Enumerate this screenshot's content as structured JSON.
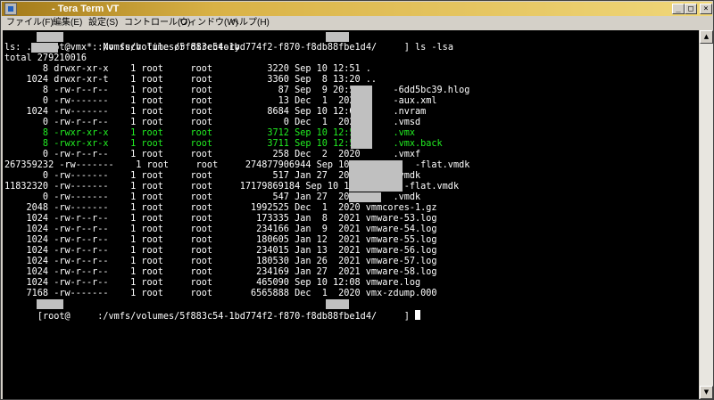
{
  "window": {
    "title": "- Tera Term VT",
    "controls": {
      "minimize": "_",
      "maximize": "□",
      "close": "×"
    }
  },
  "menu": [
    {
      "label": "ファイル(F)"
    },
    {
      "label": "編集(E)"
    },
    {
      "label": "設定(S)"
    },
    {
      "label": "コントロール(O)"
    },
    {
      "label": "ウィンドウ(W)"
    },
    {
      "label": "ヘルプ(H)"
    }
  ],
  "terminal": {
    "colors": {
      "background": "#000000",
      "text": "#ffffff",
      "highlight": "#22ee22",
      "dir": "#3060ff"
    },
    "lines": [
      {
        "text": "[root@     :/vmfs/volumes/5f883c54-1bd774f2-f870-f8db88fbe1d4/     ] ls -lsa"
      },
      {
        "text": "ls: ./     .vmx*: No such file or directory"
      },
      {
        "text": "total 279210016"
      },
      {
        "text": "       8 drwxr-xr-x    1 root     root          3220 Sep 10 12:51 ."
      },
      {
        "text": "    1024 drwxr-xr-t    1 root     root          3360 Sep  8 13:20 .."
      },
      {
        "text": "       8 -rw-r--r--    1 root     root            87 Sep  9 20:56      -6dd5bc39.hlog"
      },
      {
        "text": "       0 -rw-------    1 root     root            13 Dec  1  2020      -aux.xml"
      },
      {
        "text": "    1024 -rw-------    1 root     root          8684 Sep 10 12:08      .nvram"
      },
      {
        "text": "       0 -rw-r--r--    1 root     root             0 Dec  1  2020      .vmsd"
      },
      {
        "text": "       8 -rwxr-xr-x    1 root     root          3712 Sep 10 12:50      .vmx"
      },
      {
        "text": "       8 -rwxr-xr-x    1 root     root          3711 Sep 10 12:50      .vmx.back"
      },
      {
        "text": "       0 -rw-r--r--    1 root     root           258 Dec  2  2020      .vmxf"
      },
      {
        "text": "267359232 -rw-------    1 root     root     274877906944 Sep 10 12:08      -flat.vmdk"
      },
      {
        "text": "       0 -rw-------    1 root     root           517 Jan 27  2021      .vmdk"
      },
      {
        "text": "11832320 -rw-------    1 root     root     17179869184 Sep 10 12:08      -flat.vmdk"
      },
      {
        "text": "       0 -rw-------    1 root     root           547 Jan 27  2021      .vmdk"
      },
      {
        "text": "    2048 -rw-------    1 root     root       1992525 Dec  1  2020 vmmcores-1.gz"
      },
      {
        "text": "    1024 -rw-r--r--    1 root     root        173335 Jan  8  2021 vmware-53.log"
      },
      {
        "text": "    1024 -rw-r--r--    1 root     root        234166 Jan  9  2021 vmware-54.log"
      },
      {
        "text": "    1024 -rw-r--r--    1 root     root        180605 Jan 12  2021 vmware-55.log"
      },
      {
        "text": "    1024 -rw-r--r--    1 root     root        234015 Jan 13  2021 vmware-56.log"
      },
      {
        "text": "    1024 -rw-r--r--    1 root     root        180530 Jan 26  2021 vmware-57.log"
      },
      {
        "text": "    1024 -rw-r--r--    1 root     root        234169 Jan 27  2021 vmware-58.log"
      },
      {
        "text": "    1024 -rw-r--r--    1 root     root        465090 Sep 10 12:08 vmware.log"
      },
      {
        "text": "    7168 -rw-------    1 root     root       6565888 Dec  1  2020 vmx-zdump.000"
      },
      {
        "text": "[root@     :/vmfs/volumes/5f883c54-1bd774f2-f870-f8db88fbe1d4/     ] "
      }
    ]
  }
}
